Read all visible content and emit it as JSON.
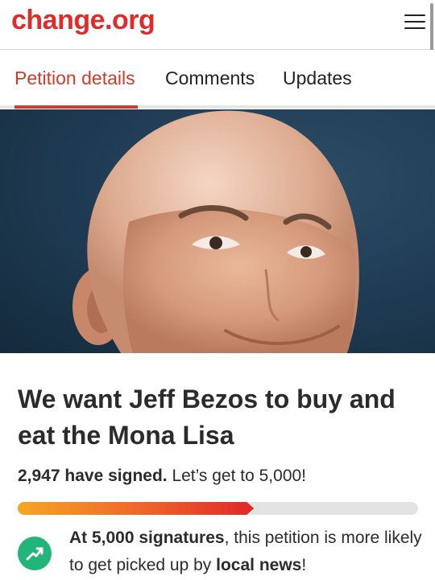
{
  "header": {
    "logo_text": "change.org",
    "menu_icon": "hamburger-menu-icon"
  },
  "tabs": [
    {
      "label": "Petition details",
      "active": true
    },
    {
      "label": "Comments",
      "active": false
    },
    {
      "label": "Updates",
      "active": false
    }
  ],
  "petition": {
    "title": "We want Jeff Bezos to buy and eat the Mona Lisa",
    "signed_count": "2,947",
    "signed_suffix": " have signed.",
    "goal_text": " Let’s get to 5,000!",
    "progress_fraction": 0.59,
    "milestone": {
      "icon": "trending-up-icon",
      "bold_1": "At 5,000 signatures",
      "text_1": ", this petition is more likely to get picked up by ",
      "bold_2": "local news",
      "text_2": "!"
    }
  },
  "colors": {
    "brand": "#e12b2b",
    "active_tab": "#d43a2b",
    "badge_green": "#21b57a"
  }
}
